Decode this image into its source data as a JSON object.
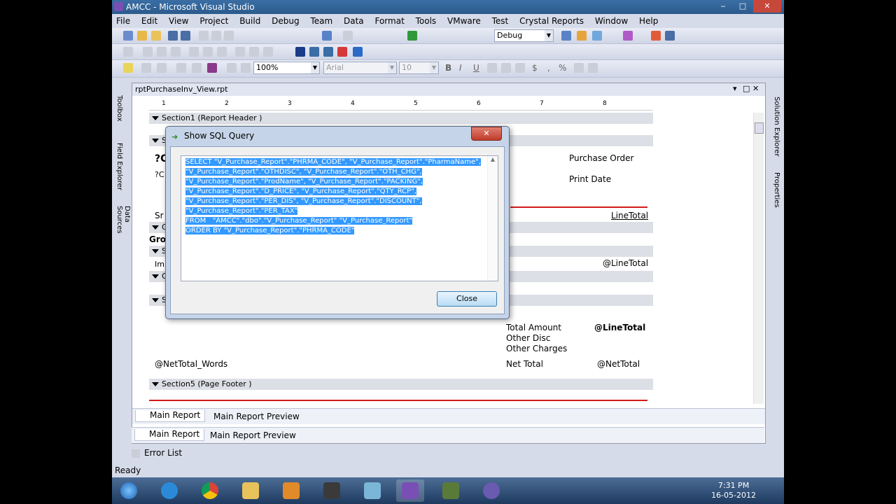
{
  "window": {
    "title": "AMCC - Microsoft Visual Studio",
    "controls": [
      "‒",
      "□",
      "✕"
    ]
  },
  "menu": [
    "File",
    "Edit",
    "View",
    "Project",
    "Build",
    "Debug",
    "Team",
    "Data",
    "Format",
    "Tools",
    "VMware",
    "Test",
    "Crystal Reports",
    "Window",
    "Help"
  ],
  "toolbar": {
    "config_combo": "Debug",
    "zoom_combo": "100%",
    "font_combo": "Arial",
    "size_combo": "10",
    "format_buttons": [
      "B",
      "I",
      "U",
      "$",
      ",",
      "%"
    ]
  },
  "left_panels": [
    "Toolbox",
    "Field Explorer",
    "Data Sources"
  ],
  "right_panels": [
    "Solution Explorer",
    "Properties"
  ],
  "document": {
    "tab_title": "rptPurchaseInv_View.rpt",
    "ruler_marks": [
      "1",
      "2",
      "3",
      "4",
      "5",
      "6",
      "7",
      "8"
    ],
    "sections": {
      "section1": "Section1 (Report Header )",
      "section5": "Section5 (Page Footer )",
      "short_labels": [
        "S",
        "G",
        "S",
        "G",
        "S"
      ]
    },
    "fields": {
      "purchase_order": "Purchase Order",
      "print_date": "Print Date",
      "line_total_header": "LineTotal",
      "line_total_detail": "@LineTotal",
      "total_amount": "Total Amount",
      "other_disc": "Other Disc",
      "other_charges": "Other Charges",
      "net_total": "Net Total",
      "line_total_bold": "@LineTotal",
      "net_total_val": "@NetTotal",
      "net_total_words": "@NetTotal_Words",
      "group_label": "Gro",
      "q_label": "?C",
      "q_label2": "?C",
      "sr_label": "Sr",
      "im_label": "Im"
    },
    "bottom_tabs": [
      "Main Report",
      "Main Report Preview"
    ]
  },
  "dialog": {
    "title": "Show SQL Query",
    "close_x": "✕",
    "sql_lines": [
      "SELECT \"V_Purchase_Report\".\"PHRMA_CODE\", \"V_Purchase_Report\".\"PharmaName\",",
      "\"V_Purchase_Report\".\"OTHDISC\", \"V_Purchase_Report\".\"OTH_CHG\",",
      "\"V_Purchase_Report\".\"ProdName\", \"V_Purchase_Report\".\"PACKING\",",
      "\"V_Purchase_Report\".\"D_PRICE\", \"V_Purchase_Report\".\"QTY_RCP\",",
      "\"V_Purchase_Report\".\"PER_DIS\", \"V_Purchase_Report\".\"DISCOUNT\",",
      "\"V_Purchase_Report\".\"PER_TAX\"",
      "FROM   \"AMCC\".\"dbo\".\"V_Purchase_Report\" \"V_Purchase_Report\"",
      "ORDER BY \"V_Purchase_Report\".\"PHRMA_CODE\""
    ],
    "close_button": "Close"
  },
  "outer_tabs": [
    "Main Report",
    "Main Report Preview"
  ],
  "error_list": "Error List",
  "status": "Ready",
  "clock": {
    "time": "7:31 PM",
    "date": "16-05-2012"
  },
  "colors": {
    "selection": "#3399ff",
    "report_rule": "#d41a1a"
  }
}
